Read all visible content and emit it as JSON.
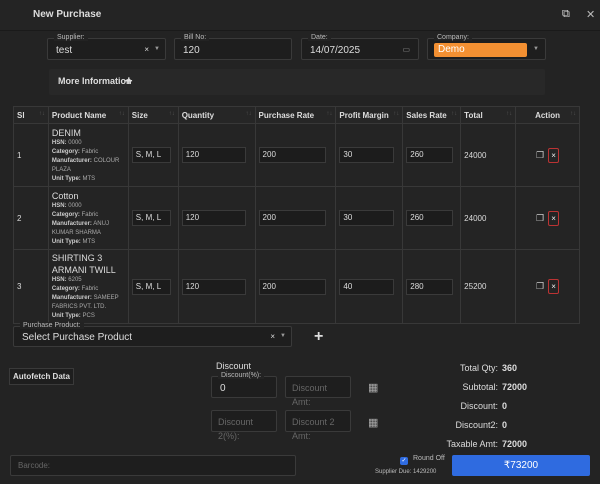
{
  "header": {
    "title": "New Purchase",
    "popout_icon": "external-link-icon",
    "close_icon": "close-icon"
  },
  "form": {
    "supplier": {
      "label": "Supplier:",
      "value": "test"
    },
    "bill_no": {
      "label": "Bill No:",
      "value": "120"
    },
    "date": {
      "label": "Date:",
      "value": "14/07/2025"
    },
    "company": {
      "label": "Company:",
      "value": "Demo",
      "color": "#f39032"
    },
    "more_info": "More Information"
  },
  "table": {
    "columns": [
      "Sl",
      "Product Name",
      "Size",
      "Quantity",
      "Purchase Rate",
      "Profit Margin",
      "Sales Rate",
      "Total",
      "Action"
    ],
    "rows": [
      {
        "sl": "1",
        "name": "DENIM",
        "hsn": "0000",
        "category": "Fabric",
        "manufacturer": "COLOUR PLAZA",
        "unit_type": "MTS",
        "size": "S, M, L",
        "quantity": "120",
        "purchase_rate": "200",
        "profit_margin": "30",
        "sales_rate": "260",
        "total": "24000"
      },
      {
        "sl": "2",
        "name": "Cotton",
        "hsn": "0000",
        "category": "Fabric",
        "manufacturer": "ANUJ KUMAR SHARMA",
        "unit_type": "MTS",
        "size": "S, M, L",
        "quantity": "120",
        "purchase_rate": "200",
        "profit_margin": "30",
        "sales_rate": "260",
        "total": "24000"
      },
      {
        "sl": "3",
        "name": "SHIRTING 3 ARMANI TWILL",
        "hsn": "6205",
        "category": "Fabric",
        "manufacturer": "SAMEEP FABRICS PVT. LTD.",
        "unit_type": "PCS",
        "size": "S, M, L",
        "quantity": "120",
        "purchase_rate": "200",
        "profit_margin": "40",
        "sales_rate": "280",
        "total": "25200"
      }
    ],
    "meta_labels": {
      "hsn": "HSN:",
      "category": "Category:",
      "manufacturer": "Manufacturer:",
      "unit_type": "Unit Type:"
    }
  },
  "purchase_product": {
    "label": "Purchase Product:",
    "placeholder": "Select Purchase Product"
  },
  "autofetch": "Autofetch Data",
  "discount": {
    "heading": "Discount",
    "pct_label": "Discount(%):",
    "pct_value": "0",
    "amt_placeholder": "Discount Amt:",
    "pct2_placeholder": "Discount 2(%):",
    "amt2_placeholder": "Discount 2 Amt:"
  },
  "summary": [
    {
      "label": "Total Qty:",
      "value": "360"
    },
    {
      "label": "Subtotal:",
      "value": "72000"
    },
    {
      "label": "Discount:",
      "value": "0"
    },
    {
      "label": "Discount2:",
      "value": "0"
    },
    {
      "label": "Taxable Amt:",
      "value": "72000"
    }
  ],
  "footer": {
    "barcode_placeholder": "Barcode:",
    "round_off": "Round Off",
    "round_off_checked": true,
    "supplier_due": "Supplier Due: 1429200",
    "total_button": "₹73200",
    "button_color": "#2f6be0"
  }
}
